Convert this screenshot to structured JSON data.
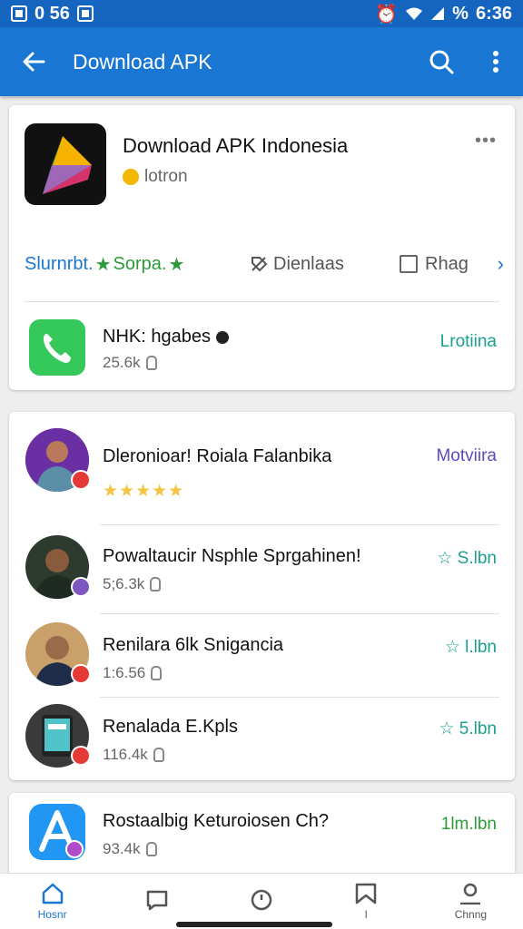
{
  "status_bar": {
    "time": "6:36",
    "left_text": "0 56",
    "percent_glyph": "%"
  },
  "app_bar": {
    "title": "Download APK",
    "back_icon": "arrow-left-icon",
    "search_icon": "search-icon",
    "more_icon": "more-vert-icon"
  },
  "featured": {
    "name": "Download APK Indonesia",
    "badge_text": "lotron",
    "more": "•••",
    "chips": {
      "first_blue": "Slurnrbt.",
      "first_star_green": "★",
      "first_green": "Sorpa.",
      "first_star_green2": "★",
      "second": "Dienlaas",
      "third": "Rhag",
      "arrow": "›"
    },
    "app_row": {
      "name": "NHK: hgabes",
      "meta": "25.6k",
      "action": "Lrotiina"
    }
  },
  "list": [
    {
      "name": "Dleronioar! Roiala Falanbika",
      "stars": "★★★★★",
      "action": "Motviira",
      "action_color": "#5a4bbf",
      "badge_color": "#e53935"
    },
    {
      "name": "Powaltaucir Nsphle Sprgahinen!",
      "meta": "5;6.3k",
      "action": "☆ S.lbn",
      "action_color": "#1aa08f",
      "badge_color": "#7e57c2"
    },
    {
      "name": "Renilara 6lk Snigancia",
      "meta": "1:6.56",
      "action": "☆ l.lbn",
      "action_color": "#1aa08f",
      "badge_color": "#e53935"
    },
    {
      "name": "Renalada E.Kpls",
      "meta": "116.4k",
      "action": "☆ 5.lbn",
      "action_color": "#1aa08f",
      "badge_color": "#e53935"
    }
  ],
  "bottom_card": {
    "name": "Rostaalbig Keturoiosen Ch?",
    "meta": "93.4k",
    "action": "1lm.lbn",
    "action_color": "#2e9b3a"
  },
  "bottom_nav": [
    {
      "label": "Hosnr",
      "icon": "home-icon",
      "active": true
    },
    {
      "label": "",
      "icon": "message-square-icon",
      "active": false
    },
    {
      "label": "",
      "icon": "clock-icon",
      "active": false
    },
    {
      "label": "l",
      "icon": "bookmark-icon",
      "active": false
    },
    {
      "label": "Chnng",
      "icon": "user-icon",
      "active": false
    }
  ]
}
